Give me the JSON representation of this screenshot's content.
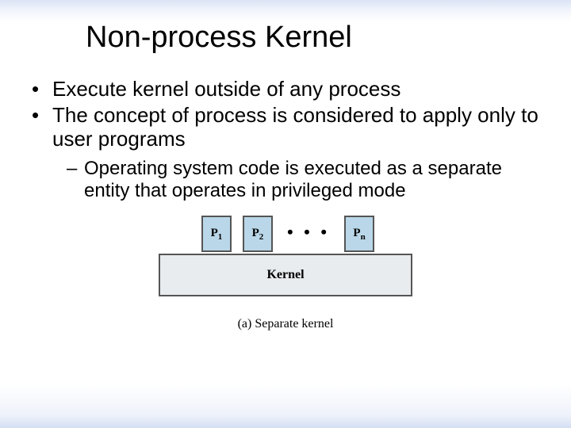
{
  "title": "Non-process Kernel",
  "bullets": {
    "b1": "Execute kernel outside of any process",
    "b2": "The concept of process is considered to apply only to user programs",
    "sub1": "Operating system code is executed as a separate entity that operates in privileged mode"
  },
  "figure": {
    "p1": "P",
    "p1_sub": "1",
    "p2": "P",
    "p2_sub": "2",
    "dots": "• • •",
    "pn": "P",
    "pn_sub": "n",
    "kernel": "Kernel",
    "caption": "(a) Separate kernel"
  }
}
